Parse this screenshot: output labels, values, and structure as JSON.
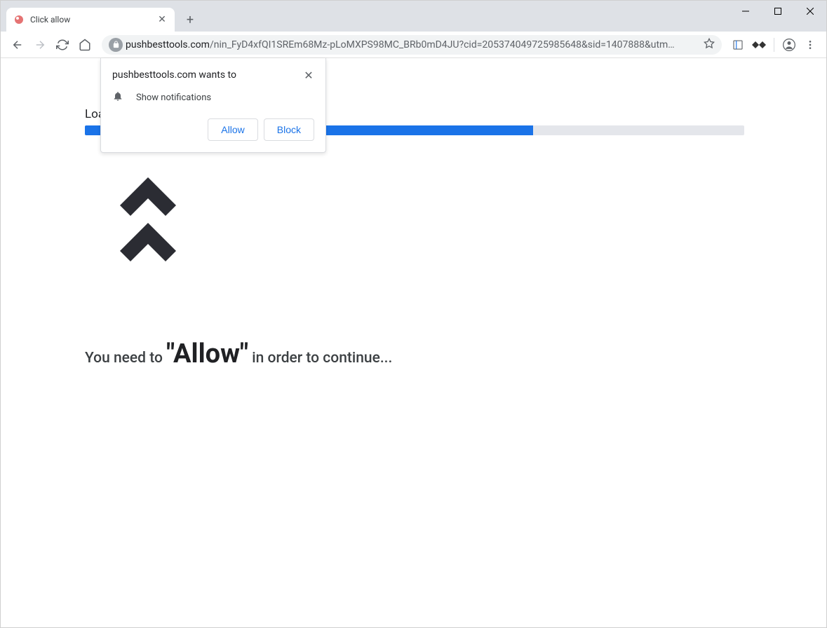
{
  "window": {
    "tab_title": "Click allow"
  },
  "toolbar": {
    "url_domain": "pushbesttools.com",
    "url_path": "/nin_FyD4xfQI1SREm68Mz-pLoMXPS98MC_BRb0mD4JU?cid=205374049725985648&sid=1407888&utm…"
  },
  "permission": {
    "title": "pushbesttools.com wants to",
    "label": "Show notifications",
    "allow": "Allow",
    "block": "Block"
  },
  "page": {
    "loading": "Loa",
    "progress_percent": 68,
    "instruction_pre": "You need to ",
    "instruction_big": "\"Allow\"",
    "instruction_post": " in order to continue..."
  }
}
